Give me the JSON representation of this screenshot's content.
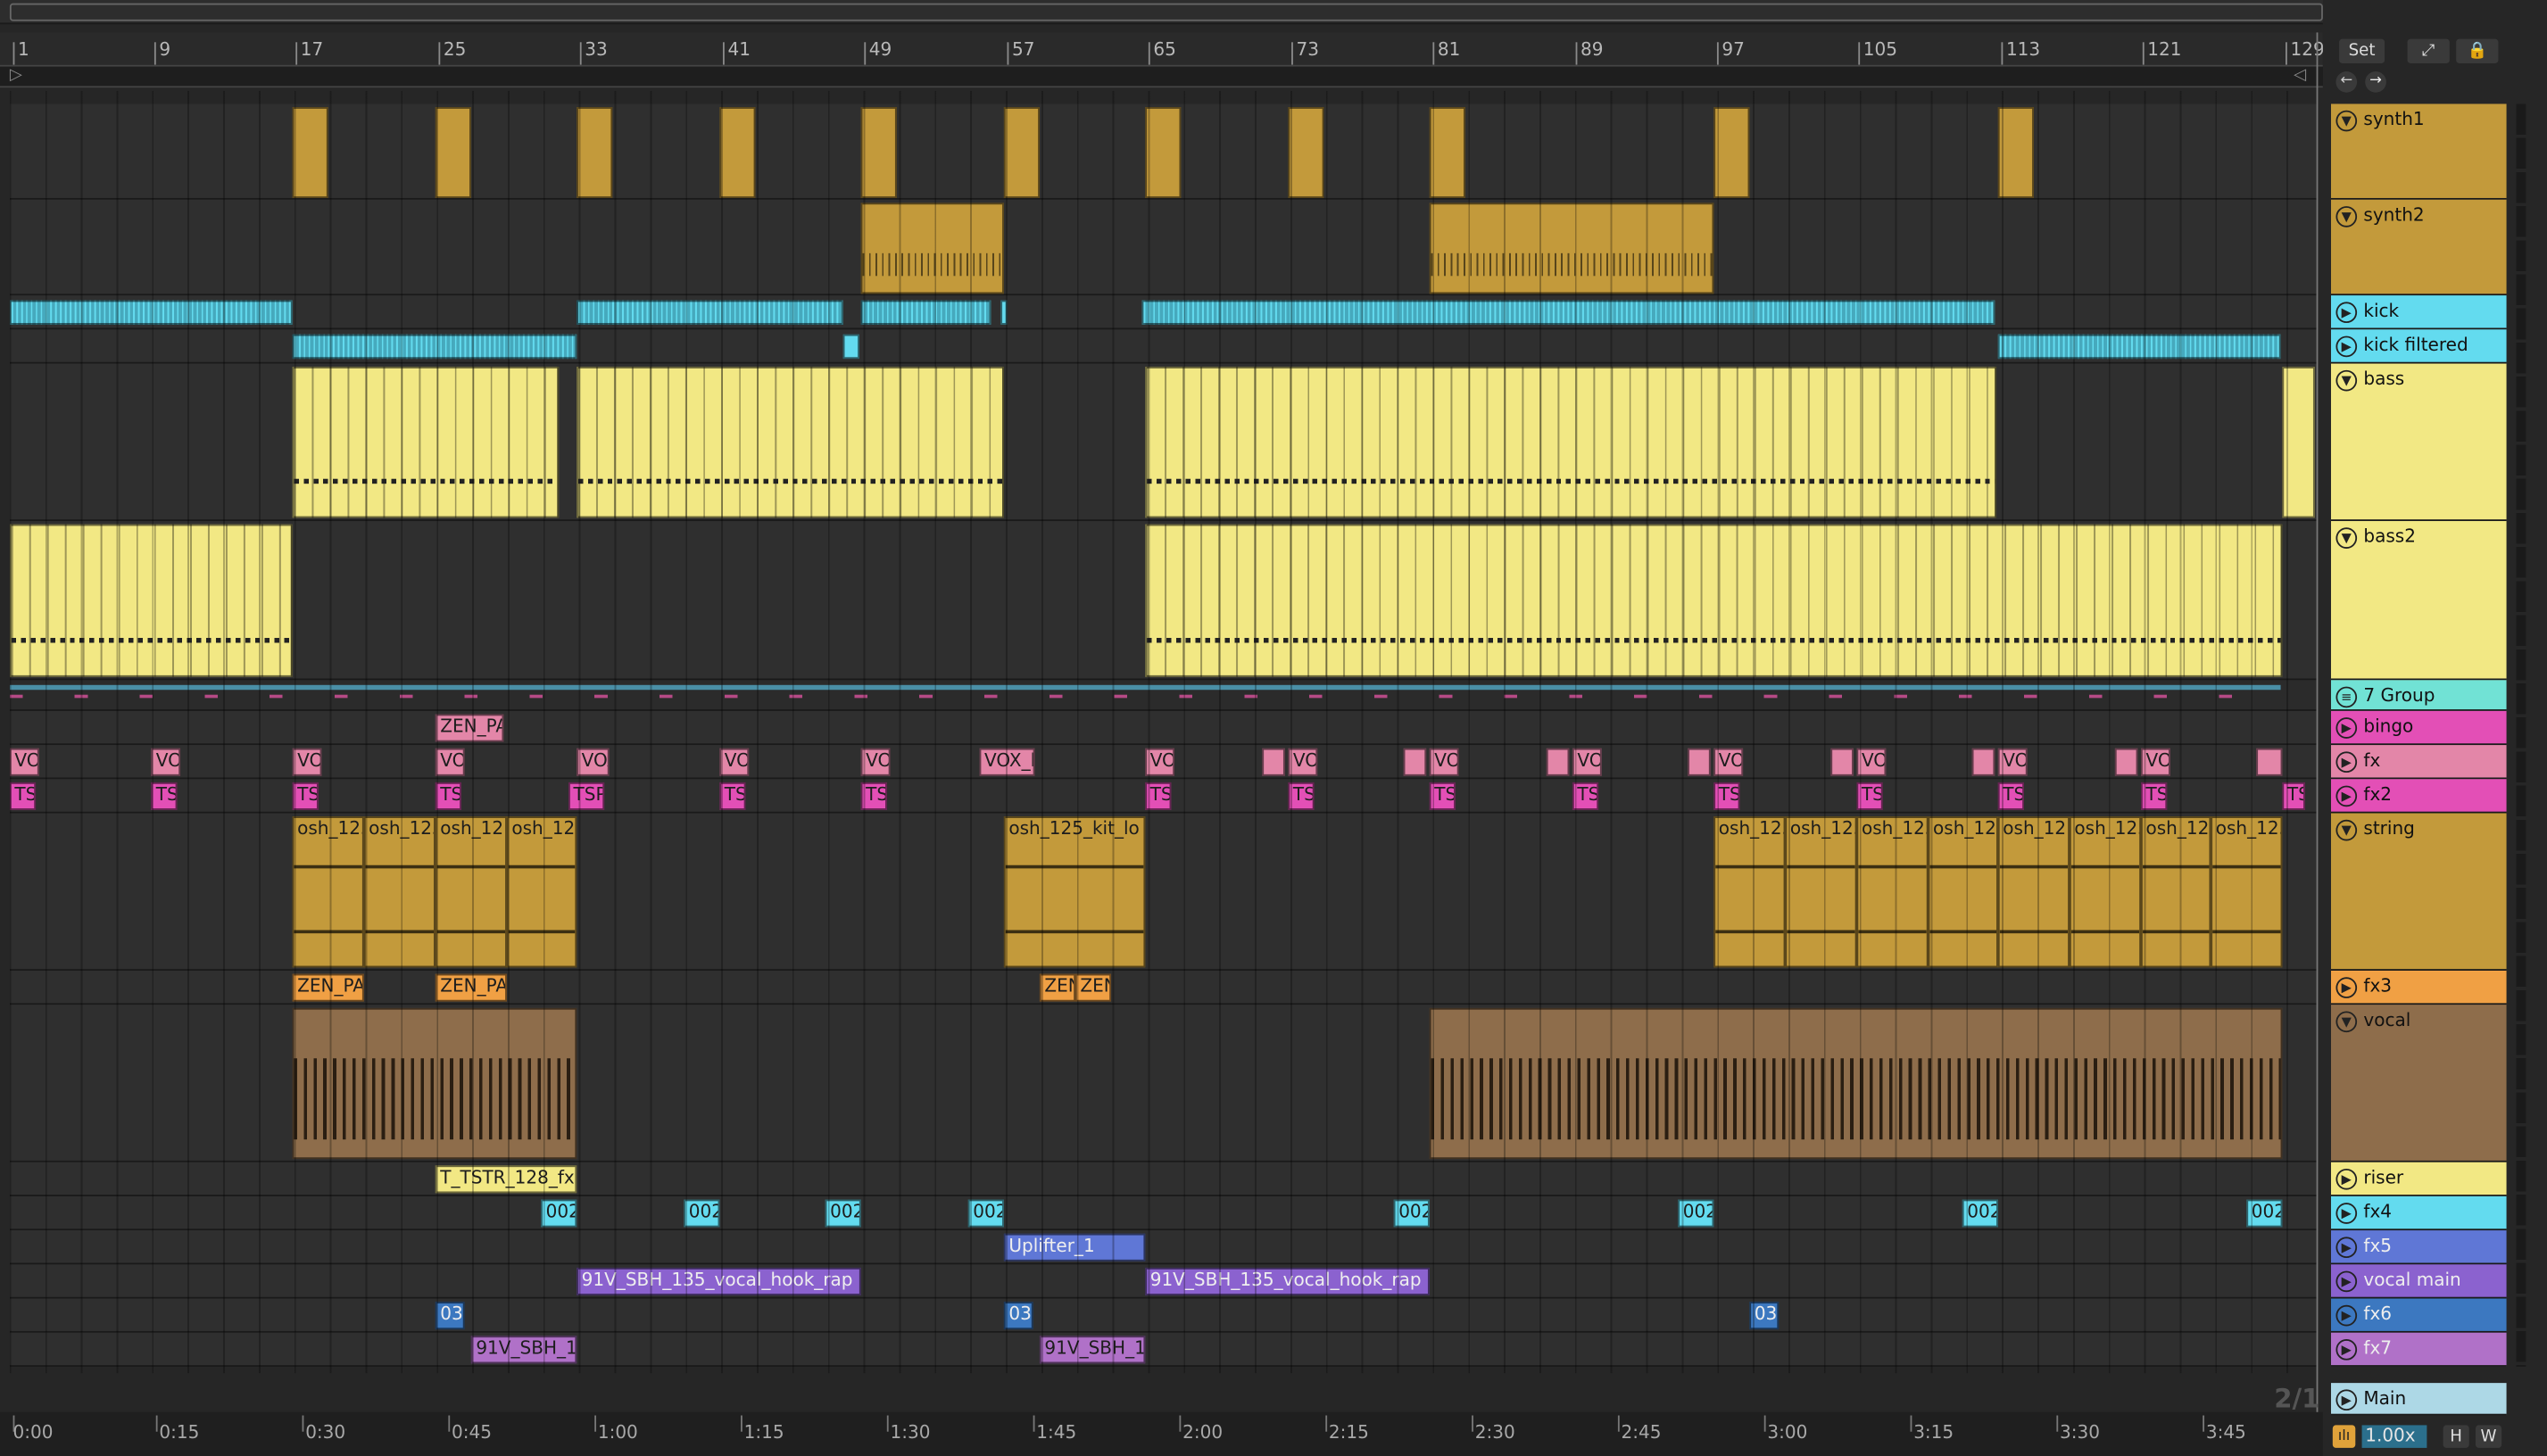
{
  "colors": {
    "gold": "#c39a3b",
    "cyan": "#63dbef",
    "yellow": "#f2e884",
    "pink": "#e386a8",
    "magenta": "#e34fb6",
    "orange": "#f0a044",
    "brown": "#8e6d4b",
    "blue": "#5f77d6",
    "purple": "#8b62cf",
    "steel": "#3c78c0",
    "lilac": "#b071c8",
    "teal": "#71e2d5",
    "lane_dark": "#2f2f2f",
    "lane_mid": "#333333"
  },
  "header": {
    "set_label": "Set",
    "page_indicator": "2/1",
    "zoom": "1.00x",
    "h_label": "H",
    "w_label": "W"
  },
  "beat_ruler": [
    "1",
    "9",
    "17",
    "25",
    "33",
    "41",
    "49",
    "57",
    "65",
    "73",
    "81",
    "89",
    "97",
    "105",
    "113",
    "121",
    "129"
  ],
  "time_ruler": [
    "0:00",
    "0:15",
    "0:30",
    "0:45",
    "1:00",
    "1:15",
    "1:30",
    "1:45",
    "2:00",
    "2:15",
    "2:30",
    "2:45",
    "3:00",
    "3:15",
    "3:30",
    "3:45"
  ],
  "tracks": [
    {
      "name": "synth1",
      "color": "#c39a3b",
      "icon": "fold-icon"
    },
    {
      "name": "synth2",
      "color": "#c39a3b",
      "icon": "fold-icon"
    },
    {
      "name": "kick",
      "color": "#63dbef",
      "icon": "play-icon"
    },
    {
      "name": "kick filtered",
      "color": "#63dbef",
      "icon": "play-icon"
    },
    {
      "name": "bass",
      "color": "#f2e884",
      "icon": "fold-icon"
    },
    {
      "name": "bass2",
      "color": "#f2e884",
      "icon": "fold-icon"
    },
    {
      "name": "7 Group",
      "color": "#71e2d5",
      "icon": "group-icon"
    },
    {
      "name": "bingo",
      "color": "#e34fb6",
      "icon": "play-icon"
    },
    {
      "name": "fx",
      "color": "#e386a8",
      "icon": "play-icon"
    },
    {
      "name": "fx2",
      "color": "#e34fb6",
      "icon": "play-icon"
    },
    {
      "name": "string",
      "color": "#c39a3b",
      "icon": "fold-icon"
    },
    {
      "name": "fx3",
      "color": "#f0a044",
      "icon": "play-icon"
    },
    {
      "name": "vocal",
      "color": "#8e6d4b",
      "icon": "fold-icon"
    },
    {
      "name": "riser",
      "color": "#f2e884",
      "icon": "play-icon"
    },
    {
      "name": "fx4",
      "color": "#63dbef",
      "icon": "play-icon"
    },
    {
      "name": "fx5",
      "color": "#5f77d6",
      "icon": "play-icon"
    },
    {
      "name": "vocal main",
      "color": "#8b62cf",
      "icon": "play-icon"
    },
    {
      "name": "fx6",
      "color": "#3c78c0",
      "icon": "play-icon"
    },
    {
      "name": "fx7",
      "color": "#b071c8",
      "icon": "play-icon"
    },
    {
      "name": "Main",
      "color": "#add8e6",
      "icon": "play-icon"
    }
  ],
  "clip_labels": {
    "zen_pa": "ZEN_PA",
    "vo": "VO",
    "vox": "VOX",
    "vox_l": "VOX_l",
    "ts": "TS",
    "tsp": "TSP",
    "osh_125": "osh_125",
    "osh_12": "osh_12",
    "osh_125_kit": "osh_125_kit_lo",
    "zen": "ZEN",
    "t_tstr": "T_TSTR_128_fx",
    "c002": "002",
    "uplifter": "Uplifter_1",
    "vocal_hook": "91V_SBH_135_vocal_hook_rap",
    "c03": "03",
    "sbh_short": "91V_SBH_1"
  }
}
